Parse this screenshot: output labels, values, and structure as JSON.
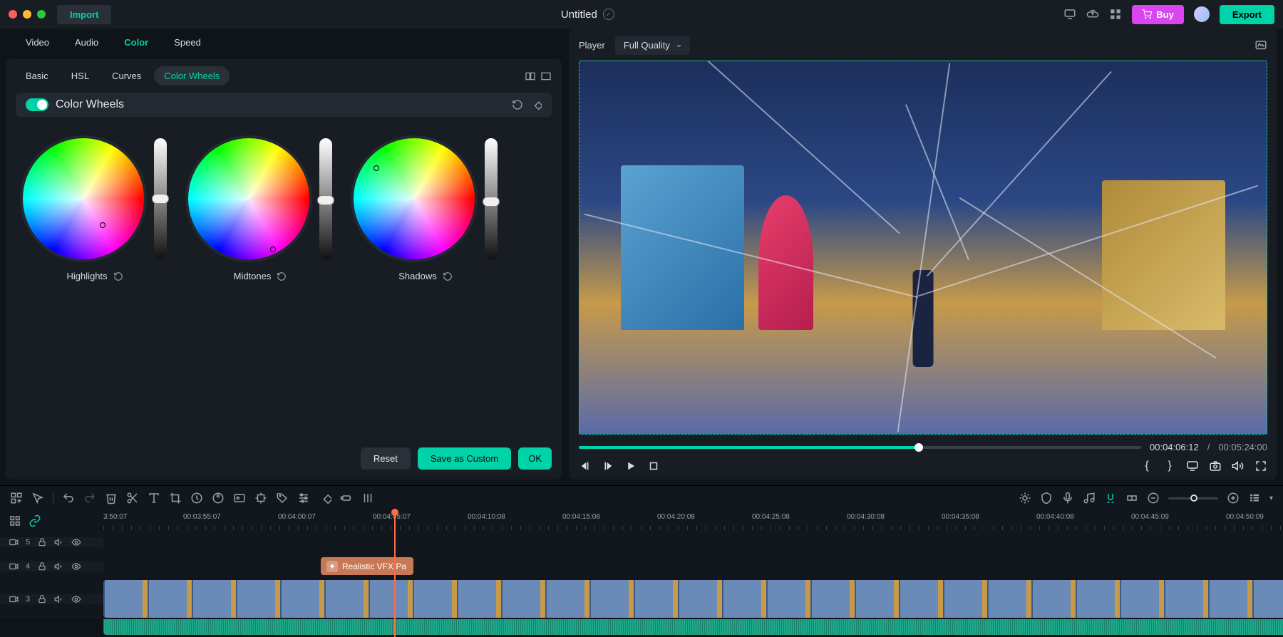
{
  "titlebar": {
    "import": "Import",
    "title": "Untitled",
    "buy": "Buy",
    "export": "Export"
  },
  "topTabs": {
    "video": "Video",
    "audio": "Audio",
    "color": "Color",
    "speed": "Speed"
  },
  "subTabs": {
    "basic": "Basic",
    "hsl": "HSL",
    "curves": "Curves",
    "wheels": "Color Wheels"
  },
  "section": {
    "colorWheels": "Color Wheels"
  },
  "wheels": {
    "highlights": "Highlights",
    "midtones": "Midtones",
    "shadows": "Shadows"
  },
  "buttons": {
    "reset": "Reset",
    "saveCustom": "Save as Custom",
    "ok": "OK"
  },
  "player": {
    "label": "Player",
    "quality": "Full Quality",
    "current": "00:04:06:12",
    "sep": "/",
    "total": "00:05:24:00"
  },
  "timeline": {
    "tracks": {
      "t5": "5",
      "t4": "4",
      "t3": "3"
    },
    "clip_vfx": "Realistic VFX Pa",
    "ruler": [
      "3:50:07",
      "00:03:55:07",
      "00:04:00:07",
      "00:04:05:07",
      "00:04:10:08",
      "00:04:15:08",
      "00:04:20:08",
      "00:04:25:08",
      "00:04:30:08",
      "00:04:35:08",
      "00:04:40:08",
      "00:04:45:09",
      "00:04:50:09"
    ]
  }
}
